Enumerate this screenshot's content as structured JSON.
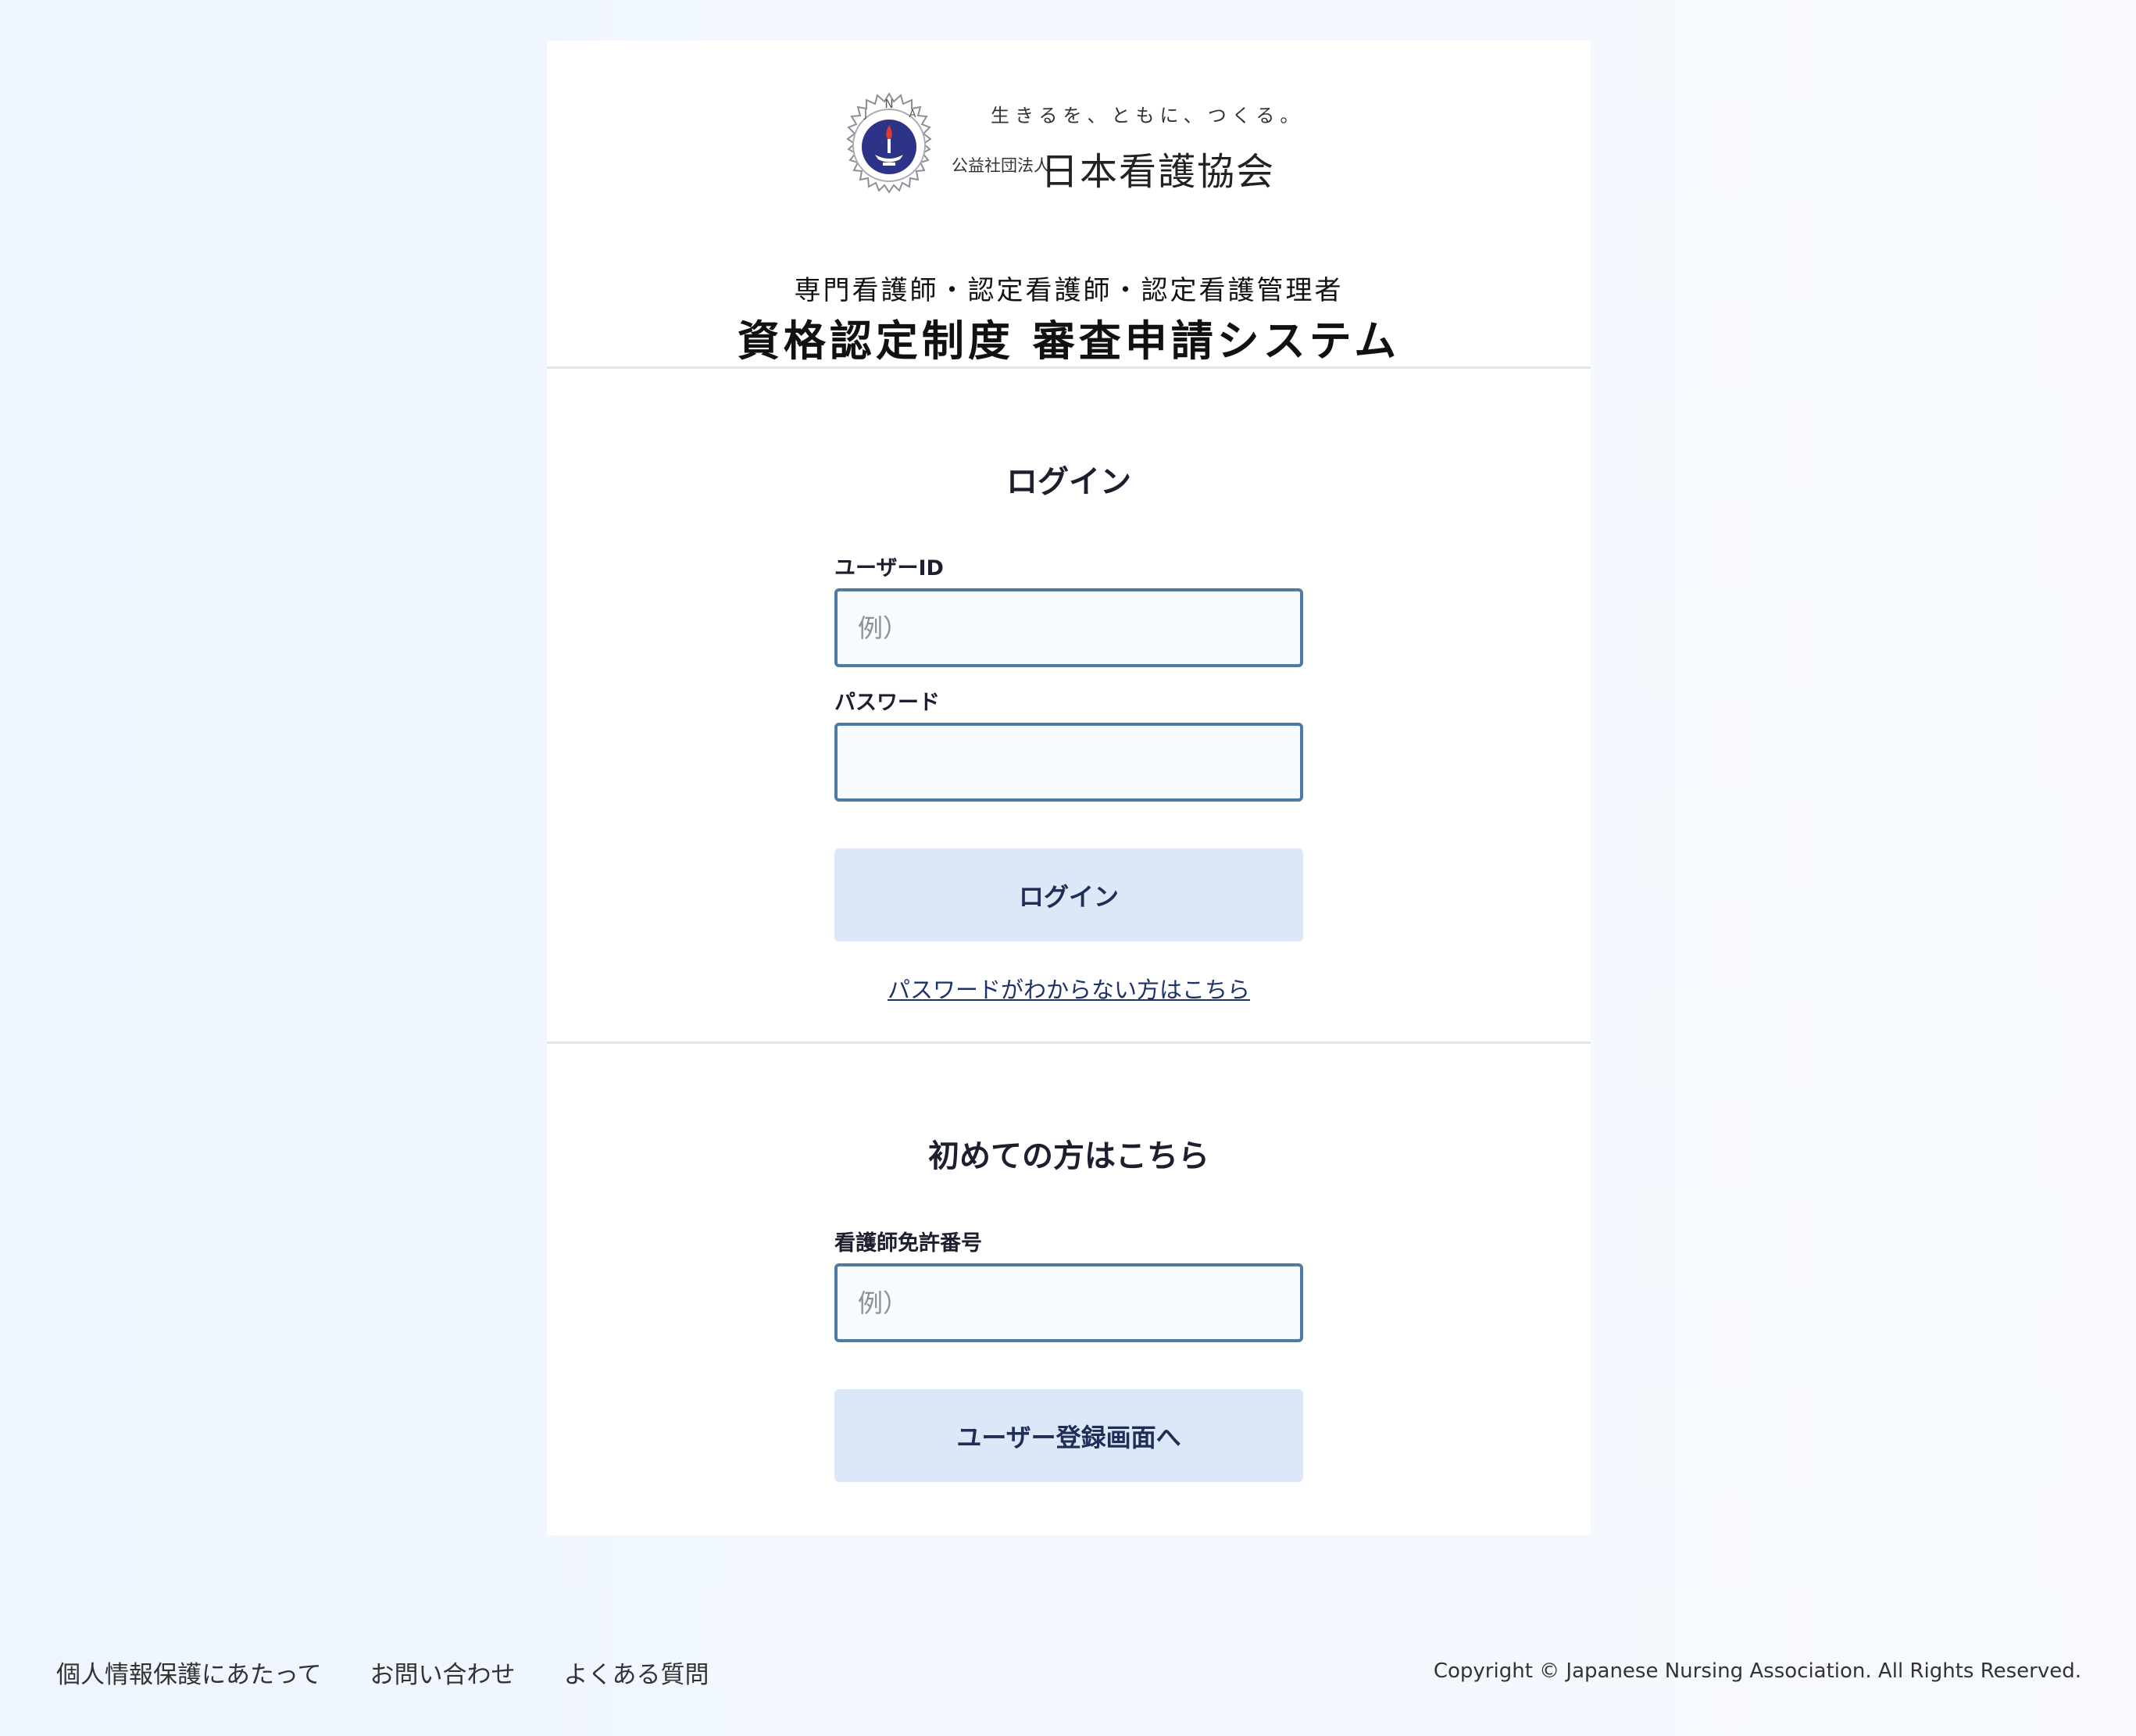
{
  "header": {
    "logo_tagline": "生きるを、ともに、つくる。",
    "logo_org_small": "公益社団法人",
    "logo_org_name": "日本看護協会",
    "system_subtitle": "専門看護師・認定看護師・認定看護管理者",
    "system_title": "資格認定制度 審査申請システム"
  },
  "login": {
    "title": "ログイン",
    "user_id_label": "ユーザーID",
    "user_id_placeholder": "例）",
    "user_id_value": "",
    "password_label": "パスワード",
    "password_value": "",
    "login_button": "ログイン",
    "forgot_link": "パスワードがわからない方はこちら"
  },
  "register": {
    "title": "初めての方はこちら",
    "license_label": "看護師免許番号",
    "license_placeholder": "例）",
    "license_value": "",
    "register_button": "ユーザー登録画面へ"
  },
  "footer": {
    "links": [
      "個人情報保護にあたって",
      "お問い合わせ",
      "よくある質問"
    ],
    "copyright": "Copyright © Japanese Nursing Association. All Rights Reserved."
  },
  "colors": {
    "input_border": "#4e7ba4",
    "button_bg": "#dce7f7",
    "button_text": "#1e2e56",
    "link_color": "#1e3366"
  },
  "icons": {
    "emblem": "jna-emblem-icon"
  }
}
